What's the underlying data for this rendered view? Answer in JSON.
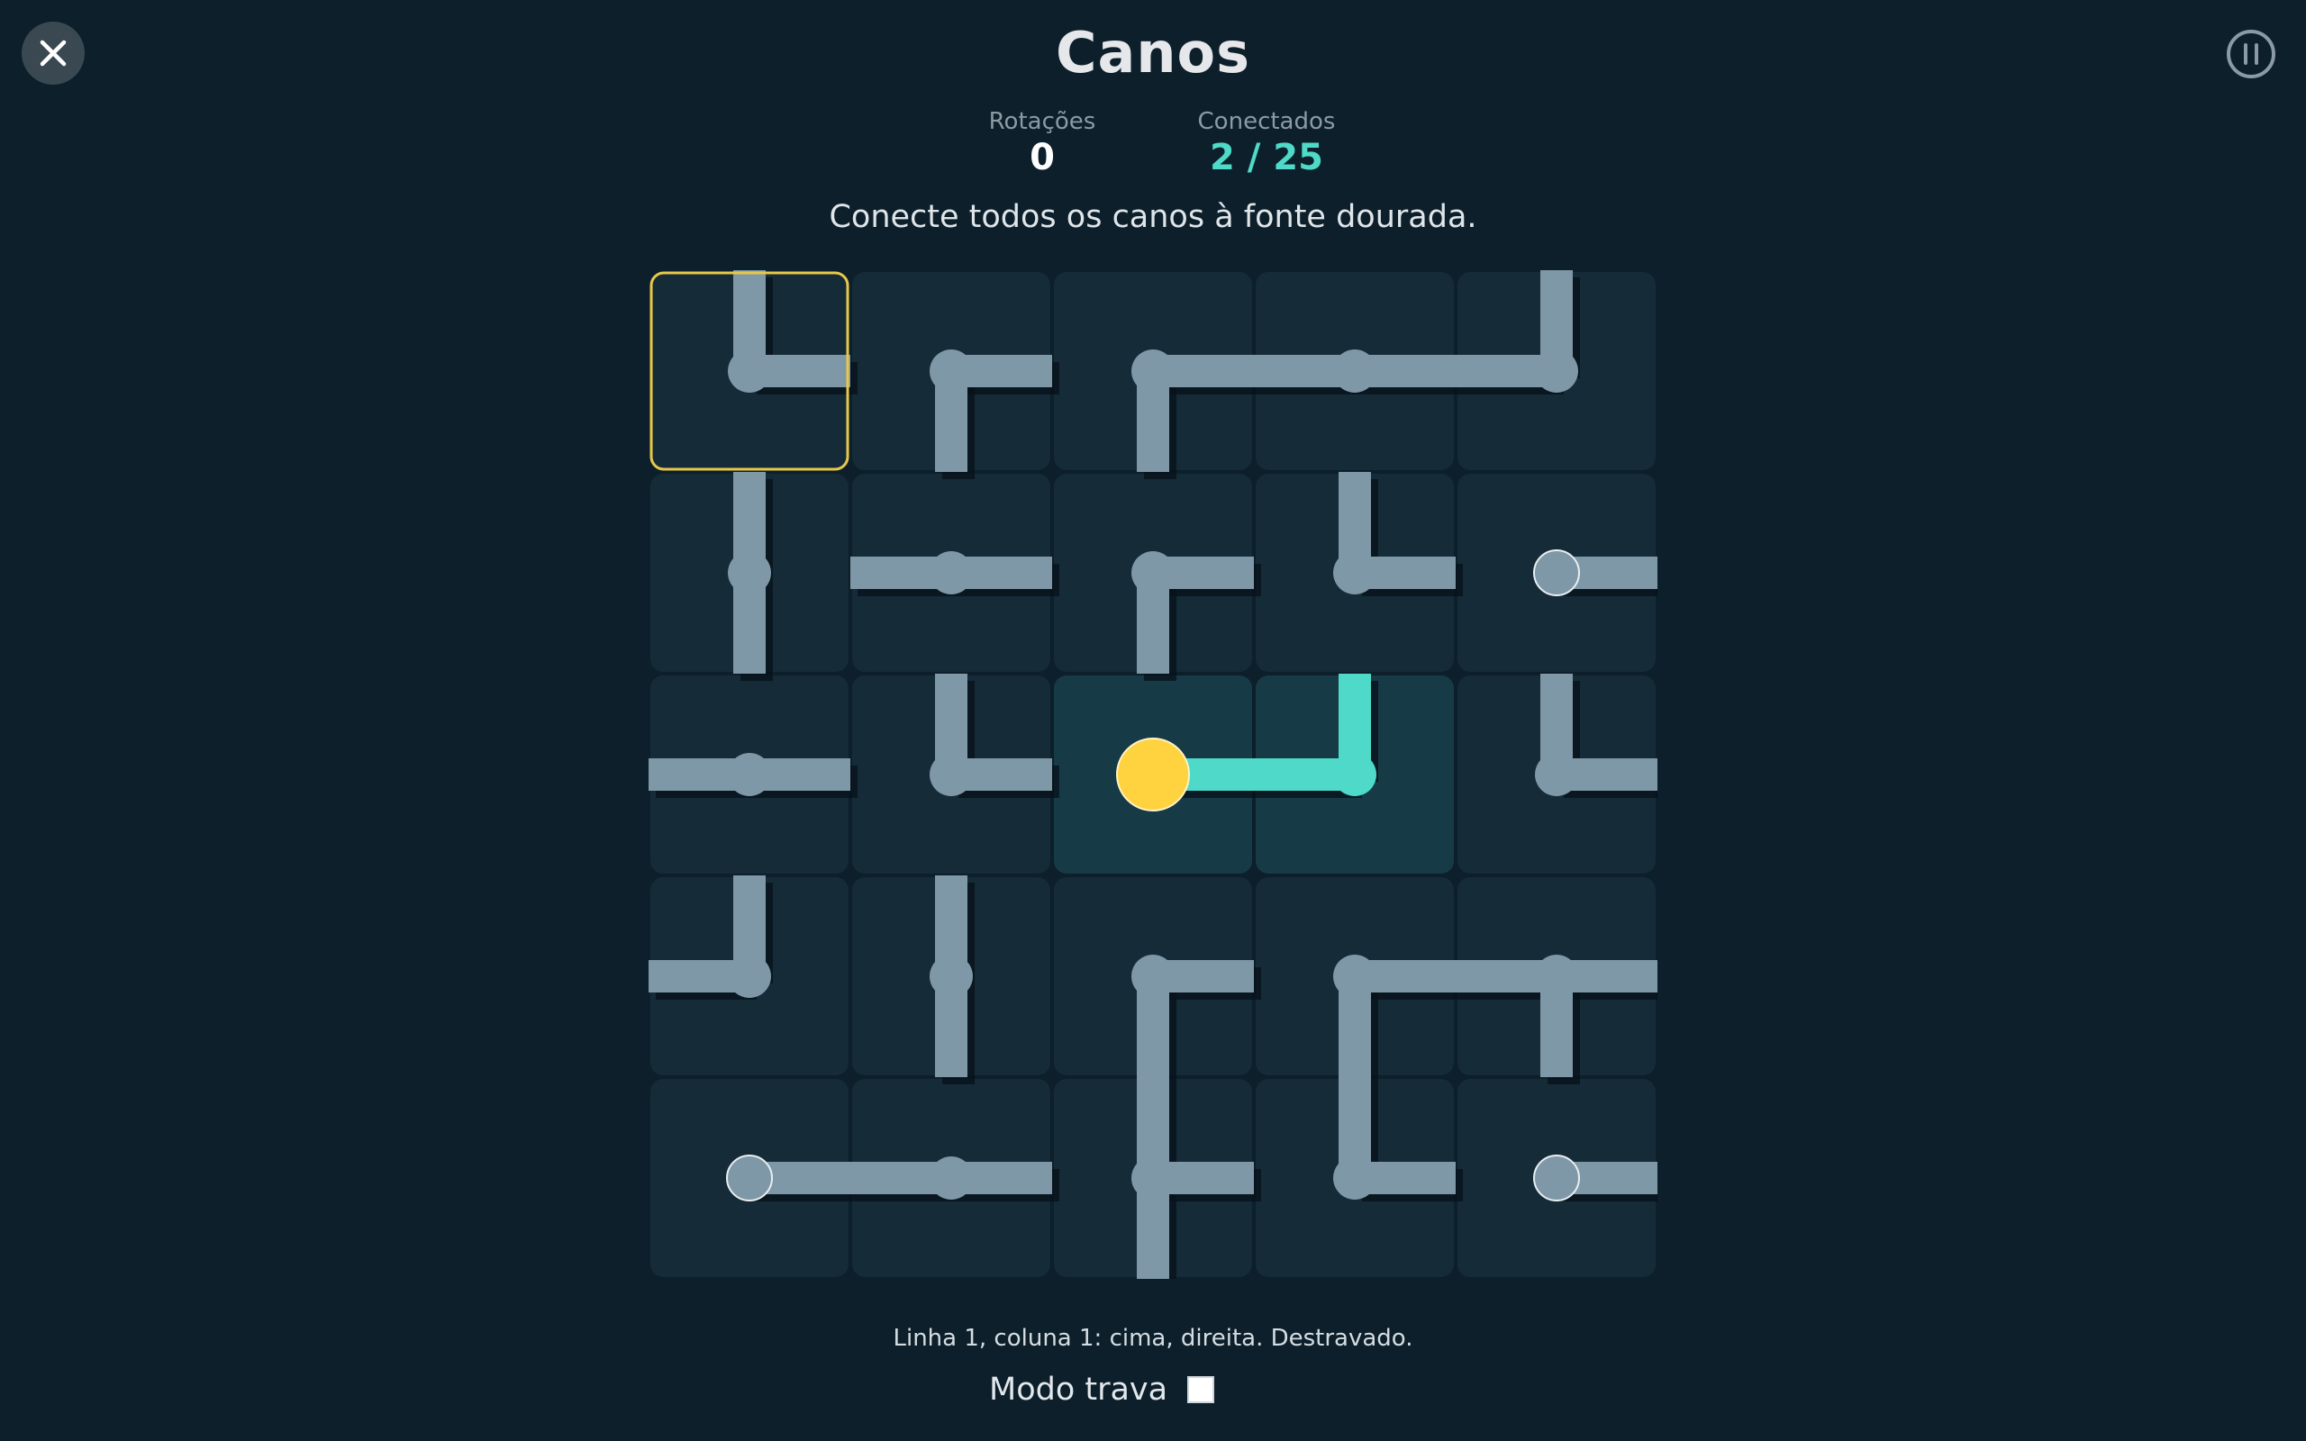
{
  "header": {
    "title": "Canos",
    "close_icon": "close-icon",
    "pause_icon": "pause-icon"
  },
  "stats": {
    "rotations_label": "Rotações",
    "rotations_value": "0",
    "connected_label": "Conectados",
    "connected_value": "2 / 25"
  },
  "instruction": "Conecte todos os canos à fonte dourada.",
  "colors": {
    "background": "#0c1f2a",
    "tile": "#152b38",
    "tile_active": "#173a47",
    "pipe": "#7f98a7",
    "pipe_connected": "#4ed9c8",
    "source": "#ffd23f",
    "selection": "#e8c84a"
  },
  "board": {
    "rows": 5,
    "cols": 5,
    "selected": [
      0,
      0
    ],
    "tiles": [
      [
        {
          "dirs": [
            "N",
            "E"
          ],
          "connected": false
        },
        {
          "dirs": [
            "E",
            "S"
          ],
          "connected": false
        },
        {
          "dirs": [
            "E",
            "S"
          ],
          "connected": false
        },
        {
          "dirs": [
            "W",
            "E"
          ],
          "connected": false
        },
        {
          "dirs": [
            "N",
            "W"
          ],
          "connected": false
        }
      ],
      [
        {
          "dirs": [
            "N",
            "S"
          ],
          "connected": false
        },
        {
          "dirs": [
            "W",
            "E"
          ],
          "connected": false
        },
        {
          "dirs": [
            "E",
            "S"
          ],
          "connected": false
        },
        {
          "dirs": [
            "N",
            "E"
          ],
          "connected": false
        },
        {
          "dirs": [
            "E"
          ],
          "connected": false,
          "endpoint": true
        }
      ],
      [
        {
          "dirs": [
            "W",
            "E"
          ],
          "connected": false
        },
        {
          "dirs": [
            "N",
            "E"
          ],
          "connected": false
        },
        {
          "dirs": [
            "E"
          ],
          "connected": true,
          "source": true
        },
        {
          "dirs": [
            "N",
            "W"
          ],
          "connected": true
        },
        {
          "dirs": [
            "N",
            "E"
          ],
          "connected": false
        }
      ],
      [
        {
          "dirs": [
            "N",
            "W"
          ],
          "connected": false
        },
        {
          "dirs": [
            "N",
            "S"
          ],
          "connected": false
        },
        {
          "dirs": [
            "E",
            "S"
          ],
          "connected": false
        },
        {
          "dirs": [
            "E",
            "S"
          ],
          "connected": false
        },
        {
          "dirs": [
            "W",
            "E",
            "S"
          ],
          "connected": false
        }
      ],
      [
        {
          "dirs": [
            "E"
          ],
          "connected": false,
          "endpoint": true
        },
        {
          "dirs": [
            "W",
            "E"
          ],
          "connected": false
        },
        {
          "dirs": [
            "N",
            "E",
            "S"
          ],
          "connected": false
        },
        {
          "dirs": [
            "N",
            "E"
          ],
          "connected": false
        },
        {
          "dirs": [
            "E"
          ],
          "connected": false,
          "endpoint": true
        }
      ]
    ]
  },
  "status_text": "Linha 1, coluna 1: cima, direita. Destravado.",
  "lock_mode": {
    "label": "Modo trava",
    "checked": false
  }
}
